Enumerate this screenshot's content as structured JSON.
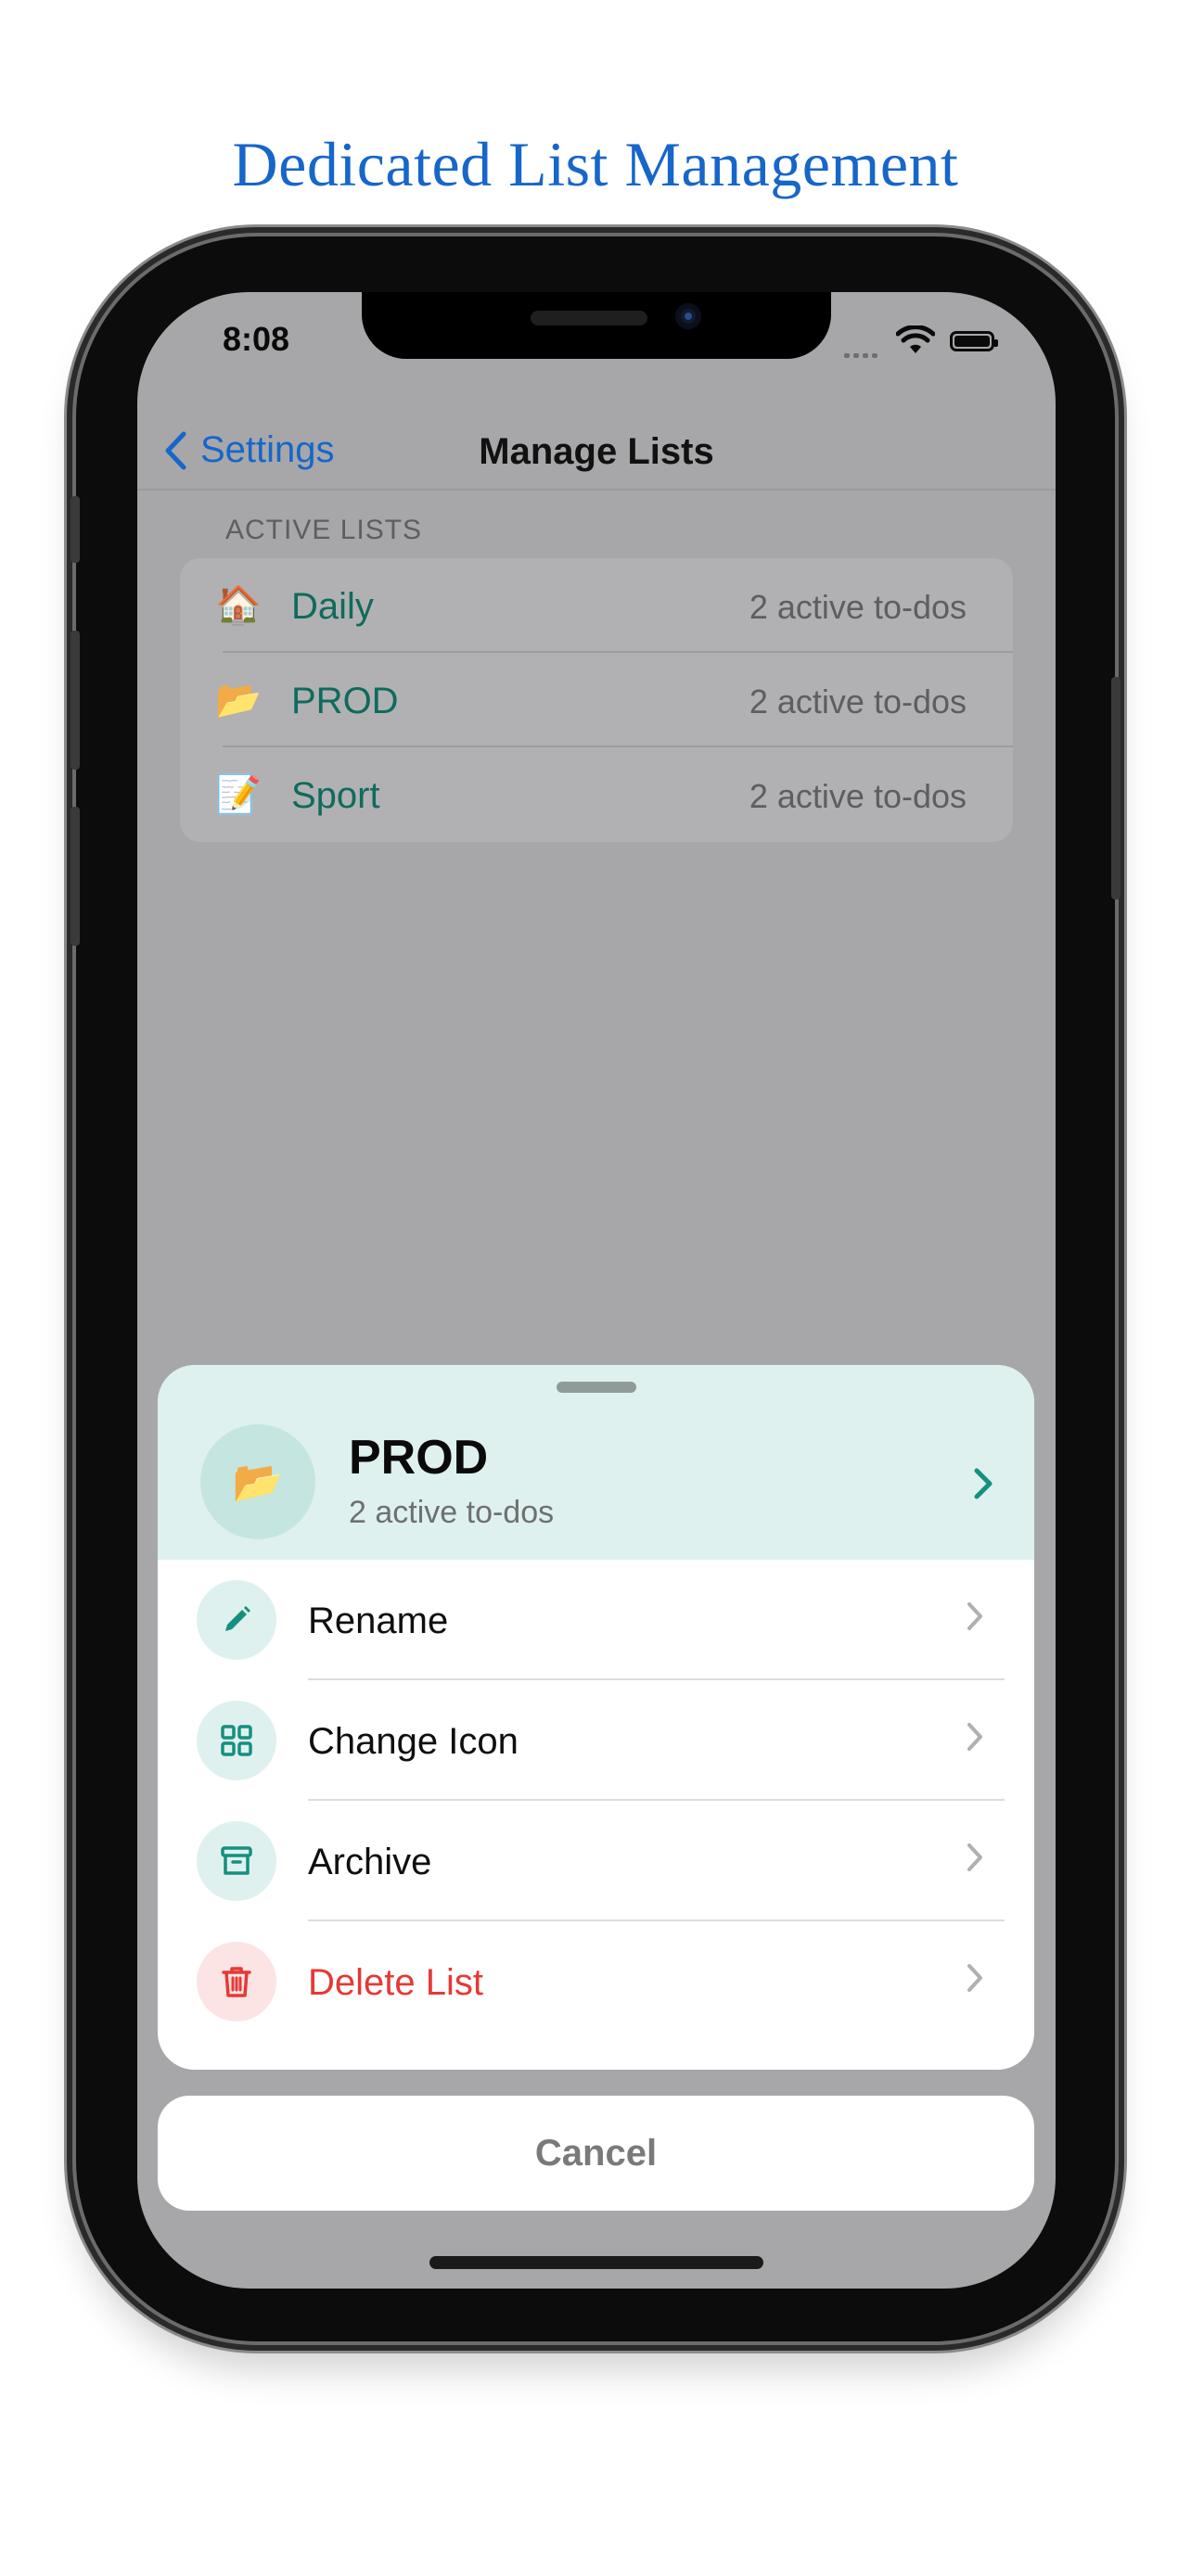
{
  "headline": "Dedicated List Management",
  "status_bar": {
    "time": "8:08"
  },
  "nav": {
    "back_label": "Settings",
    "title": "Manage Lists"
  },
  "section_label": "ACTIVE LISTS",
  "lists": [
    {
      "emoji": "🏠",
      "name": "Daily",
      "count": "2 active to-dos"
    },
    {
      "emoji": "📂",
      "name": "PROD",
      "count": "2 active to-dos"
    },
    {
      "emoji": "📝",
      "name": "Sport",
      "count": "2 active to-dos"
    }
  ],
  "sheet": {
    "emoji": "📂",
    "title": "PROD",
    "subtitle": "2 active to-dos",
    "actions": [
      {
        "label": "Rename",
        "icon": "pencil-icon"
      },
      {
        "label": "Change Icon",
        "icon": "grid-icon"
      },
      {
        "label": "Archive",
        "icon": "archive-box-icon"
      },
      {
        "label": "Delete List",
        "icon": "trash-icon"
      }
    ],
    "cancel_label": "Cancel"
  },
  "colors": {
    "accent_teal": "#15907e",
    "link_blue": "#1766c9",
    "danger_red": "#e53935",
    "list_name": "#0f6b5c"
  }
}
